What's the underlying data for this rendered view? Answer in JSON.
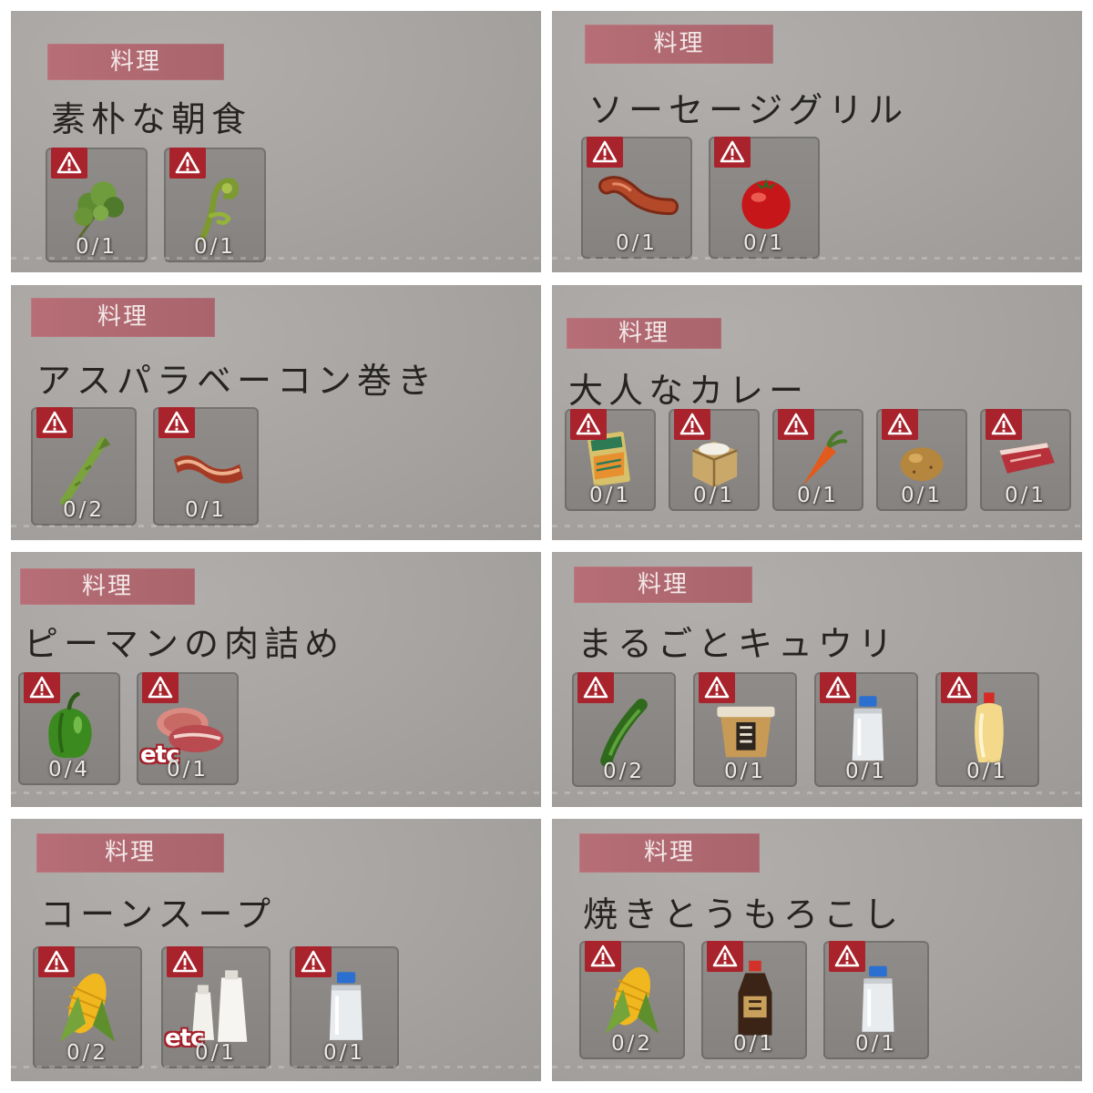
{
  "recipes": [
    {
      "tag": "料理",
      "title": "素朴な朝食",
      "ingredients": [
        {
          "icon": "parsley-icon",
          "count": "0/1",
          "etc": null
        },
        {
          "icon": "fern-sprout-icon",
          "count": "0/1",
          "etc": null
        }
      ]
    },
    {
      "tag": "料理",
      "title": "ソーセージグリル",
      "ingredients": [
        {
          "icon": "sausage-icon",
          "count": "0/1",
          "etc": null
        },
        {
          "icon": "tomato-icon",
          "count": "0/1",
          "etc": null
        }
      ]
    },
    {
      "tag": "料理",
      "title": "アスパラベーコン巻き",
      "ingredients": [
        {
          "icon": "asparagus-icon",
          "count": "0/2",
          "etc": null
        },
        {
          "icon": "bacon-icon",
          "count": "0/1",
          "etc": null
        }
      ]
    },
    {
      "tag": "料理",
      "title": "大人なカレー",
      "ingredients": [
        {
          "icon": "curry-pack-icon",
          "count": "0/1",
          "etc": null
        },
        {
          "icon": "rice-box-icon",
          "count": "0/1",
          "etc": null
        },
        {
          "icon": "carrot-icon",
          "count": "0/1",
          "etc": null
        },
        {
          "icon": "potato-icon",
          "count": "0/1",
          "etc": null
        },
        {
          "icon": "beef-icon",
          "count": "0/1",
          "etc": null
        }
      ]
    },
    {
      "tag": "料理",
      "title": "ピーマンの肉詰め",
      "ingredients": [
        {
          "icon": "green-pepper-icon",
          "count": "0/4",
          "etc": null
        },
        {
          "icon": "meat-icon",
          "count": "0/1",
          "etc": "etc"
        }
      ]
    },
    {
      "tag": "料理",
      "title": "まるごとキュウリ",
      "ingredients": [
        {
          "icon": "cucumber-icon",
          "count": "0/2",
          "etc": null
        },
        {
          "icon": "miso-tub-icon",
          "count": "0/1",
          "etc": null
        },
        {
          "icon": "salt-bottle-icon",
          "count": "0/1",
          "etc": null
        },
        {
          "icon": "mayonnaise-icon",
          "count": "0/1",
          "etc": null
        }
      ]
    },
    {
      "tag": "料理",
      "title": "コーンスープ",
      "ingredients": [
        {
          "icon": "corn-icon",
          "count": "0/2",
          "etc": null
        },
        {
          "icon": "milk-bottles-icon",
          "count": "0/1",
          "etc": "etc"
        },
        {
          "icon": "salt-bottle-icon",
          "count": "0/1",
          "etc": null
        }
      ]
    },
    {
      "tag": "料理",
      "title": "焼きとうもろこし",
      "ingredients": [
        {
          "icon": "corn-icon",
          "count": "0/2",
          "etc": null
        },
        {
          "icon": "soy-sauce-icon",
          "count": "0/1",
          "etc": null
        },
        {
          "icon": "salt-bottle-icon",
          "count": "0/1",
          "etc": null
        }
      ]
    }
  ],
  "colors": {
    "tag": "#b06a72",
    "warn": "#a8232c",
    "panel": "#a6a3a0"
  }
}
